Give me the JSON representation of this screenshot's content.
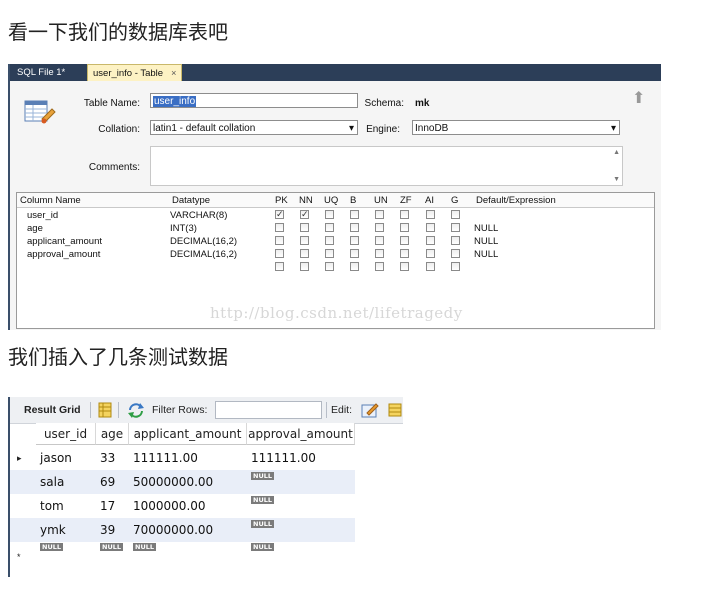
{
  "headings": {
    "first": "看一下我们的数据库表吧",
    "second": "我们插入了几条测试数据"
  },
  "workbench": {
    "tabs": [
      {
        "label": "SQL File 1*"
      },
      {
        "label": "user_info - Table",
        "close": "×"
      }
    ],
    "table_name_label": "Table Name:",
    "table_name_value": "user_info",
    "schema_label": "Schema:",
    "schema_value": "mk",
    "collation_label": "Collation:",
    "collation_value": "latin1 - default collation",
    "engine_label": "Engine:",
    "engine_value": "InnoDB",
    "comments_label": "Comments:",
    "column_headers": [
      "Column Name",
      "Datatype",
      "PK",
      "NN",
      "UQ",
      "B",
      "UN",
      "ZF",
      "AI",
      "G",
      "Default/Expression"
    ],
    "columns": [
      {
        "name": "user_id",
        "type": "VARCHAR(8)",
        "flags": [
          true,
          true,
          false,
          false,
          false,
          false,
          false,
          false
        ],
        "default": ""
      },
      {
        "name": "age",
        "type": "INT(3)",
        "flags": [
          false,
          false,
          false,
          false,
          false,
          false,
          false,
          false
        ],
        "default": "NULL"
      },
      {
        "name": "applicant_amount",
        "type": "DECIMAL(16,2)",
        "flags": [
          false,
          false,
          false,
          false,
          false,
          false,
          false,
          false
        ],
        "default": "NULL"
      },
      {
        "name": "approval_amount",
        "type": "DECIMAL(16,2)",
        "flags": [
          false,
          false,
          false,
          false,
          false,
          false,
          false,
          false
        ],
        "default": "NULL"
      }
    ],
    "watermark": "http://blog.csdn.net/lifetragedy"
  },
  "result_grid": {
    "label": "Result Grid",
    "filter_label": "Filter Rows:",
    "edit_label": "Edit:",
    "headers": [
      "user_id",
      "age",
      "applicant_amount",
      "approval_amount"
    ],
    "rows": [
      [
        "jason",
        "33",
        "111111.00",
        "111111.00"
      ],
      [
        "sala",
        "69",
        "50000000.00",
        "NULL"
      ],
      [
        "tom",
        "17",
        "1000000.00",
        "NULL"
      ],
      [
        "ymk",
        "39",
        "70000000.00",
        "NULL"
      ]
    ],
    "new_row": [
      "NULL",
      "NULL",
      "NULL",
      "NULL"
    ],
    "current_row_marker": "▸",
    "new_row_marker": "*"
  }
}
